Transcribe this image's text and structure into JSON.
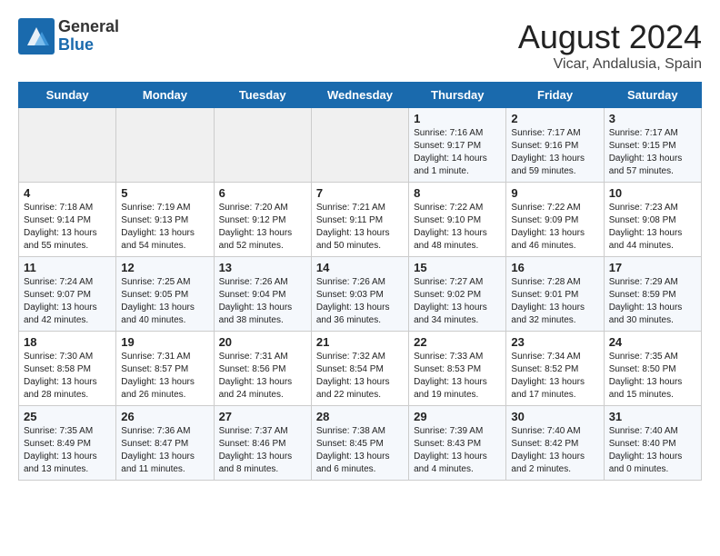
{
  "header": {
    "logo_general": "General",
    "logo_blue": "Blue",
    "month_year": "August 2024",
    "location": "Vicar, Andalusia, Spain"
  },
  "days_of_week": [
    "Sunday",
    "Monday",
    "Tuesday",
    "Wednesday",
    "Thursday",
    "Friday",
    "Saturday"
  ],
  "weeks": [
    [
      {
        "day": "",
        "empty": true
      },
      {
        "day": "",
        "empty": true
      },
      {
        "day": "",
        "empty": true
      },
      {
        "day": "",
        "empty": true
      },
      {
        "day": "1",
        "info": "Sunrise: 7:16 AM\nSunset: 9:17 PM\nDaylight: 14 hours\nand 1 minute."
      },
      {
        "day": "2",
        "info": "Sunrise: 7:17 AM\nSunset: 9:16 PM\nDaylight: 13 hours\nand 59 minutes."
      },
      {
        "day": "3",
        "info": "Sunrise: 7:17 AM\nSunset: 9:15 PM\nDaylight: 13 hours\nand 57 minutes."
      }
    ],
    [
      {
        "day": "4",
        "info": "Sunrise: 7:18 AM\nSunset: 9:14 PM\nDaylight: 13 hours\nand 55 minutes."
      },
      {
        "day": "5",
        "info": "Sunrise: 7:19 AM\nSunset: 9:13 PM\nDaylight: 13 hours\nand 54 minutes."
      },
      {
        "day": "6",
        "info": "Sunrise: 7:20 AM\nSunset: 9:12 PM\nDaylight: 13 hours\nand 52 minutes."
      },
      {
        "day": "7",
        "info": "Sunrise: 7:21 AM\nSunset: 9:11 PM\nDaylight: 13 hours\nand 50 minutes."
      },
      {
        "day": "8",
        "info": "Sunrise: 7:22 AM\nSunset: 9:10 PM\nDaylight: 13 hours\nand 48 minutes."
      },
      {
        "day": "9",
        "info": "Sunrise: 7:22 AM\nSunset: 9:09 PM\nDaylight: 13 hours\nand 46 minutes."
      },
      {
        "day": "10",
        "info": "Sunrise: 7:23 AM\nSunset: 9:08 PM\nDaylight: 13 hours\nand 44 minutes."
      }
    ],
    [
      {
        "day": "11",
        "info": "Sunrise: 7:24 AM\nSunset: 9:07 PM\nDaylight: 13 hours\nand 42 minutes."
      },
      {
        "day": "12",
        "info": "Sunrise: 7:25 AM\nSunset: 9:05 PM\nDaylight: 13 hours\nand 40 minutes."
      },
      {
        "day": "13",
        "info": "Sunrise: 7:26 AM\nSunset: 9:04 PM\nDaylight: 13 hours\nand 38 minutes."
      },
      {
        "day": "14",
        "info": "Sunrise: 7:26 AM\nSunset: 9:03 PM\nDaylight: 13 hours\nand 36 minutes."
      },
      {
        "day": "15",
        "info": "Sunrise: 7:27 AM\nSunset: 9:02 PM\nDaylight: 13 hours\nand 34 minutes."
      },
      {
        "day": "16",
        "info": "Sunrise: 7:28 AM\nSunset: 9:01 PM\nDaylight: 13 hours\nand 32 minutes."
      },
      {
        "day": "17",
        "info": "Sunrise: 7:29 AM\nSunset: 8:59 PM\nDaylight: 13 hours\nand 30 minutes."
      }
    ],
    [
      {
        "day": "18",
        "info": "Sunrise: 7:30 AM\nSunset: 8:58 PM\nDaylight: 13 hours\nand 28 minutes."
      },
      {
        "day": "19",
        "info": "Sunrise: 7:31 AM\nSunset: 8:57 PM\nDaylight: 13 hours\nand 26 minutes."
      },
      {
        "day": "20",
        "info": "Sunrise: 7:31 AM\nSunset: 8:56 PM\nDaylight: 13 hours\nand 24 minutes."
      },
      {
        "day": "21",
        "info": "Sunrise: 7:32 AM\nSunset: 8:54 PM\nDaylight: 13 hours\nand 22 minutes."
      },
      {
        "day": "22",
        "info": "Sunrise: 7:33 AM\nSunset: 8:53 PM\nDaylight: 13 hours\nand 19 minutes."
      },
      {
        "day": "23",
        "info": "Sunrise: 7:34 AM\nSunset: 8:52 PM\nDaylight: 13 hours\nand 17 minutes."
      },
      {
        "day": "24",
        "info": "Sunrise: 7:35 AM\nSunset: 8:50 PM\nDaylight: 13 hours\nand 15 minutes."
      }
    ],
    [
      {
        "day": "25",
        "info": "Sunrise: 7:35 AM\nSunset: 8:49 PM\nDaylight: 13 hours\nand 13 minutes."
      },
      {
        "day": "26",
        "info": "Sunrise: 7:36 AM\nSunset: 8:47 PM\nDaylight: 13 hours\nand 11 minutes."
      },
      {
        "day": "27",
        "info": "Sunrise: 7:37 AM\nSunset: 8:46 PM\nDaylight: 13 hours\nand 8 minutes."
      },
      {
        "day": "28",
        "info": "Sunrise: 7:38 AM\nSunset: 8:45 PM\nDaylight: 13 hours\nand 6 minutes."
      },
      {
        "day": "29",
        "info": "Sunrise: 7:39 AM\nSunset: 8:43 PM\nDaylight: 13 hours\nand 4 minutes."
      },
      {
        "day": "30",
        "info": "Sunrise: 7:40 AM\nSunset: 8:42 PM\nDaylight: 13 hours\nand 2 minutes."
      },
      {
        "day": "31",
        "info": "Sunrise: 7:40 AM\nSunset: 8:40 PM\nDaylight: 13 hours\nand 0 minutes."
      }
    ]
  ]
}
